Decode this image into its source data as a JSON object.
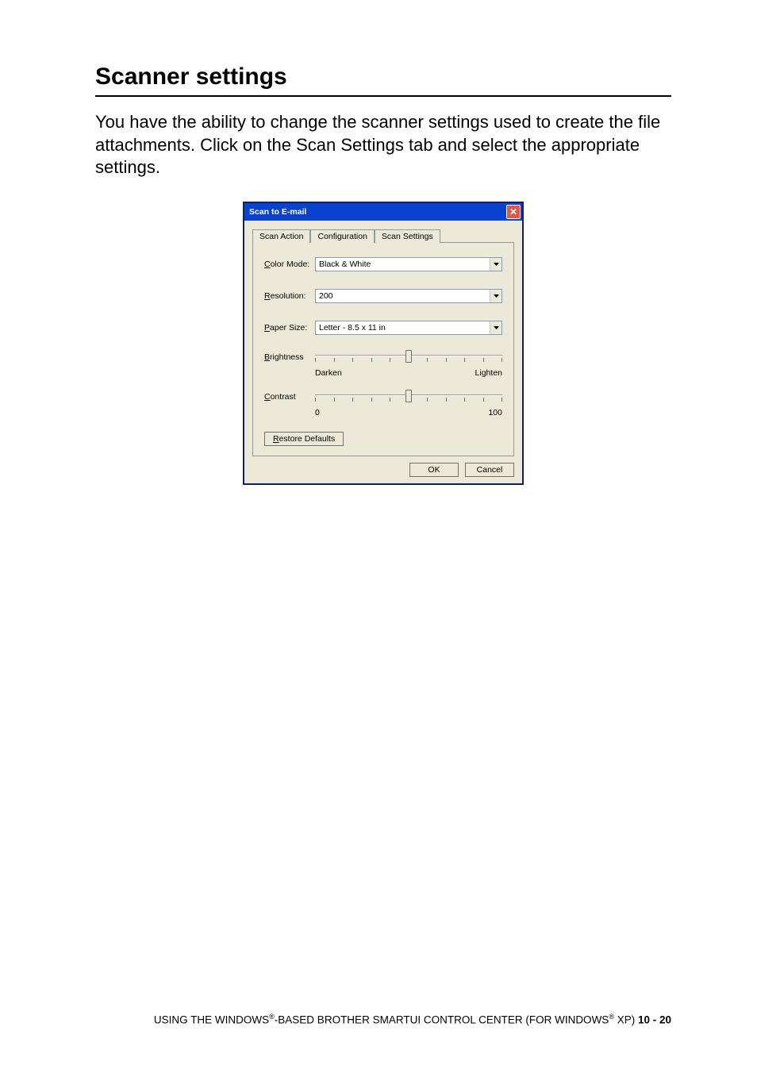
{
  "page": {
    "heading": "Scanner settings",
    "body": "You have the ability to change the scanner settings used to create the file attachments. Click on the Scan Settings tab and select the appropriate settings."
  },
  "dialog": {
    "title": "Scan to E-mail",
    "tabs": {
      "scan_action": "Scan Action",
      "configuration": "Configuration",
      "scan_settings": "Scan Settings"
    },
    "fields": {
      "color_mode_label": "Color Mode:",
      "color_mode_value": "Black & White",
      "resolution_label": "Resolution:",
      "resolution_value": "200",
      "paper_size_label": "Paper Size:",
      "paper_size_value": "Letter - 8.5  x 11 in"
    },
    "sliders": {
      "brightness_label": "Brightness",
      "brightness_left": "Darken",
      "brightness_right": "Lighten",
      "contrast_label": "Contrast",
      "contrast_left": "0",
      "contrast_right": "100"
    },
    "buttons": {
      "restore": "Restore Defaults",
      "ok": "OK",
      "cancel": "Cancel"
    }
  },
  "footer": {
    "text_a": "USING THE WINDOWS",
    "reg": "®",
    "text_b": "-BASED BROTHER SMARTUI CONTROL CENTER (FOR WINDOWS",
    "text_c": " XP)   ",
    "page_num": "10 - 20"
  }
}
